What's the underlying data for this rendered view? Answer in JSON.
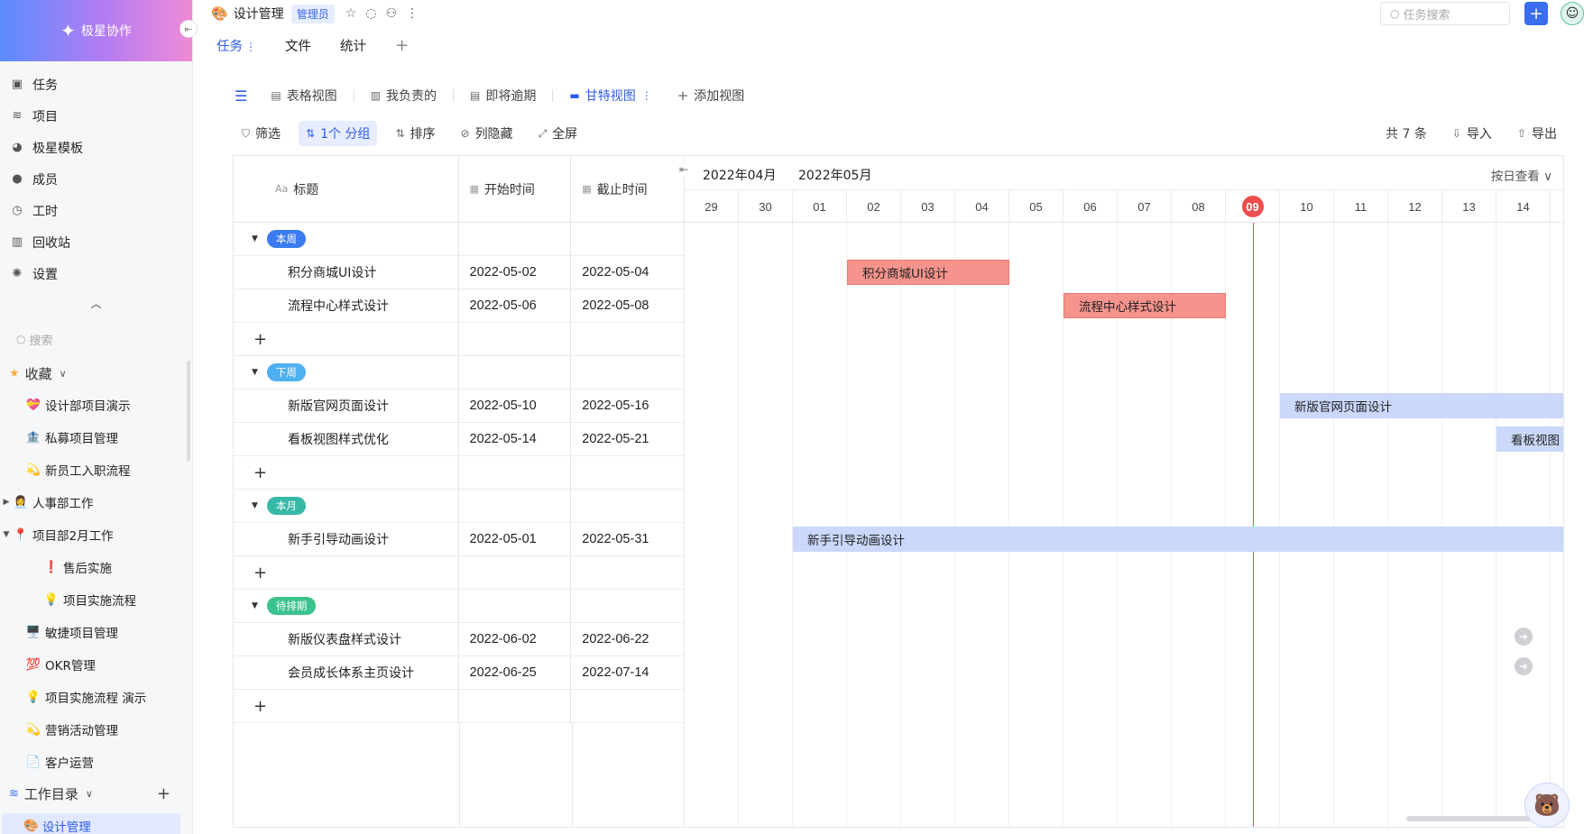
{
  "app": {
    "logo_text": "极星协作"
  },
  "sidebar": {
    "nav": [
      {
        "label": "任务",
        "icon": "task-icon"
      },
      {
        "label": "项目",
        "icon": "layers-icon"
      },
      {
        "label": "极星模板",
        "icon": "template-icon"
      },
      {
        "label": "成员",
        "icon": "user-icon"
      },
      {
        "label": "工时",
        "icon": "clock-icon"
      },
      {
        "label": "回收站",
        "icon": "trash-icon"
      },
      {
        "label": "设置",
        "icon": "gear-icon"
      }
    ],
    "search_placeholder": "搜索",
    "favorites_label": "收藏",
    "favorites": [
      {
        "emoji": "💝",
        "label": "设计部项目演示"
      },
      {
        "emoji": "🏦",
        "label": "私募项目管理"
      },
      {
        "emoji": "💫",
        "label": "新员工入职流程"
      },
      {
        "emoji": "👩‍💼",
        "label": "人事部工作"
      },
      {
        "emoji": "📍",
        "label": "项目部2月工作"
      },
      {
        "emoji": "❗",
        "label": "售后实施"
      },
      {
        "emoji": "💡",
        "label": "项目实施流程"
      },
      {
        "emoji": "🖥️",
        "label": "敏捷项目管理"
      },
      {
        "emoji": "💯",
        "label": "OKR管理"
      },
      {
        "emoji": "💡",
        "label": "项目实施流程 演示"
      },
      {
        "emoji": "💫",
        "label": "营销活动管理"
      },
      {
        "emoji": "📄",
        "label": "客户运营"
      }
    ],
    "workdir_label": "工作目录",
    "active_item": "设计管理"
  },
  "topbar": {
    "project_title": "设计管理",
    "role_badge": "管理员",
    "search_placeholder": "任务搜索"
  },
  "tabs": [
    "任务",
    "文件",
    "统计"
  ],
  "views": [
    "表格视图",
    "我负责的",
    "即将逾期",
    "甘特视图",
    "添加视图"
  ],
  "toolbar": {
    "filter": "筛选",
    "group": "1个 分组",
    "sort": "排序",
    "hide_columns": "列隐藏",
    "fullscreen": "全屏",
    "count": "共 7 条",
    "import": "导入",
    "export": "导出"
  },
  "table": {
    "headers": {
      "title": "标题",
      "start": "开始时间",
      "end": "截止时间"
    },
    "groups": [
      {
        "label": "本周",
        "color": "#3a7bf0",
        "tasks": [
          {
            "title": "积分商城UI设计",
            "start": "2022-05-02",
            "end": "2022-05-04"
          },
          {
            "title": "流程中心样式设计",
            "start": "2022-05-06",
            "end": "2022-05-08"
          }
        ]
      },
      {
        "label": "下周",
        "color": "#4fb0ef",
        "tasks": [
          {
            "title": "新版官网页面设计",
            "start": "2022-05-10",
            "end": "2022-05-16"
          },
          {
            "title": "看板视图样式优化",
            "start": "2022-05-14",
            "end": "2022-05-21"
          }
        ]
      },
      {
        "label": "本月",
        "color": "#37b9a8",
        "tasks": [
          {
            "title": "新手引导动画设计",
            "start": "2022-05-01",
            "end": "2022-05-31"
          }
        ]
      },
      {
        "label": "待排期",
        "color": "#3cc38d",
        "tasks": [
          {
            "title": "新版仪表盘样式设计",
            "start": "2022-06-02",
            "end": "2022-06-22"
          },
          {
            "title": "会员成长体系主页设计",
            "start": "2022-06-25",
            "end": "2022-07-14"
          }
        ]
      }
    ]
  },
  "gantt": {
    "months": [
      "2022年04月",
      "2022年05月"
    ],
    "scale_label": "按日查看",
    "days": [
      "29",
      "30",
      "01",
      "02",
      "03",
      "04",
      "05",
      "06",
      "07",
      "08",
      "09",
      "10",
      "11",
      "12",
      "13",
      "14"
    ],
    "today": "09",
    "bars": [
      {
        "label": "积分商城UI设计",
        "start_day": "02",
        "end_day": "04",
        "style": "red"
      },
      {
        "label": "流程中心样式设计",
        "start_day": "06",
        "end_day": "08",
        "style": "red"
      },
      {
        "label": "新版官网页面设计",
        "start_day": "10",
        "end_day": "16",
        "style": "blue"
      },
      {
        "label": "看板视图",
        "start_day": "14",
        "end_day": "21",
        "style": "blue"
      },
      {
        "label": "新手引导动画设计",
        "start_day": "01",
        "end_day": "31",
        "style": "blue"
      }
    ]
  }
}
